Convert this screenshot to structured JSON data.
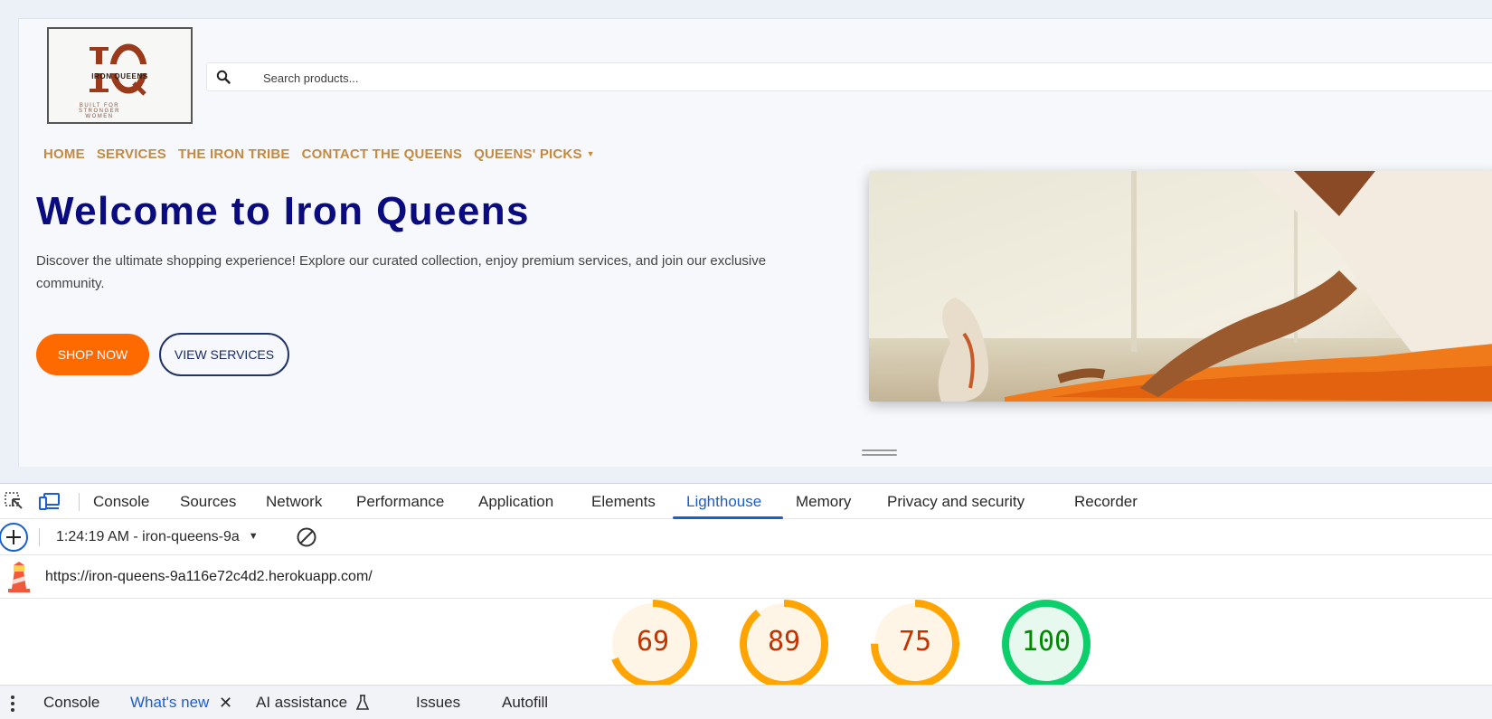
{
  "site": {
    "logo": {
      "monogram": "IQ",
      "name": "IRON QUEENS",
      "tagline": "BUILT FOR STRONGER WOMEN"
    },
    "search": {
      "placeholder": "Search products..."
    },
    "nav": [
      {
        "label": "HOME"
      },
      {
        "label": "SERVICES"
      },
      {
        "label": "THE IRON TRIBE"
      },
      {
        "label": "CONTACT THE QUEENS"
      },
      {
        "label": "QUEENS' PICKS",
        "dropdown": true
      }
    ],
    "hero": {
      "title": "Welcome to Iron Queens",
      "description": "Discover the ultimate shopping experience! Explore our curated collection, enjoy premium services, and join our exclusive community.",
      "primary_button": "SHOP NOW",
      "secondary_button": "VIEW SERVICES"
    }
  },
  "devtools": {
    "tabs": [
      "Console",
      "Sources",
      "Network",
      "Performance",
      "Application",
      "Elements",
      "Lighthouse",
      "Memory",
      "Privacy and security",
      "Recorder"
    ],
    "active_tab": "Lighthouse",
    "report_select": "1:24:19 AM - iron-queens-9a",
    "url": "https://iron-queens-9a116e72c4d2.herokuapp.com/",
    "scores": [
      {
        "value": "69",
        "color": "#ffa400"
      },
      {
        "value": "89",
        "color": "#ffa400"
      },
      {
        "value": "75",
        "color": "#ffa400"
      },
      {
        "value": "100",
        "color": "#0cce6b"
      }
    ],
    "drawer_tabs": [
      "Console",
      "What's new",
      "AI assistance",
      "Issues",
      "Autofill"
    ],
    "active_drawer_tab": "What's new"
  },
  "colors": {
    "accent_blue": "#1a5fd0",
    "nav_gold": "#c48a3f",
    "hero_title_navy": "#0b0b80",
    "shop_orange": "#ff6a00",
    "score_average": "#ffa400",
    "score_good": "#0cce6b"
  }
}
